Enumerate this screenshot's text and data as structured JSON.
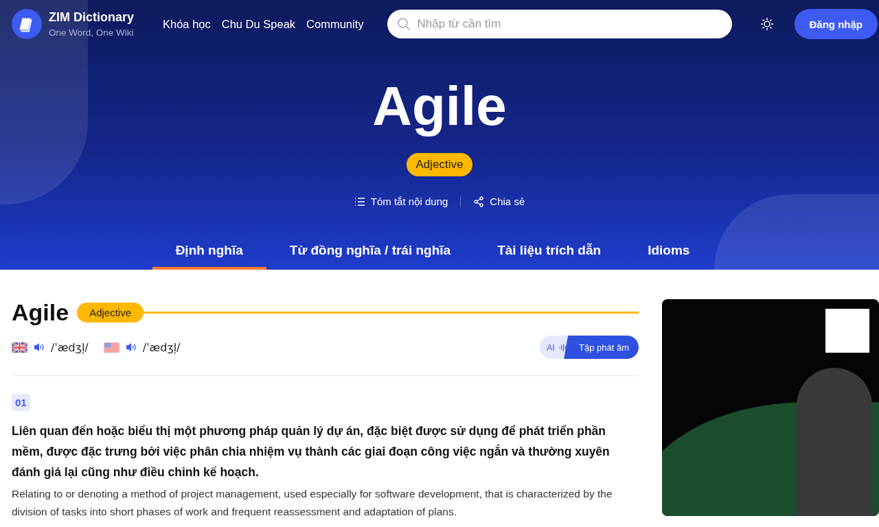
{
  "header": {
    "brand": {
      "name": "ZIM Dictionary",
      "tagline": "One Word, One Wiki"
    },
    "nav": [
      "Khóa học",
      "Chu Du Speak",
      "Community"
    ],
    "search": {
      "placeholder": "Nhập từ cần tìm"
    },
    "login": "Đăng nhập"
  },
  "hero": {
    "word": "Agile",
    "pos": "Adjective",
    "actions": [
      {
        "kind": "summary",
        "label": "Tóm tắt nội dung"
      },
      {
        "kind": "share",
        "label": "Chia sẻ"
      }
    ]
  },
  "tabs": [
    {
      "label": "Định nghĩa",
      "selected": true
    },
    {
      "label": "Từ đồng nghĩa / trái nghĩa",
      "selected": false
    },
    {
      "label": "Tài liệu trích dẫn",
      "selected": false
    },
    {
      "label": "Idioms",
      "selected": false
    }
  ],
  "entry": {
    "word": "Agile",
    "pos": "Adjective",
    "pronunciations": [
      {
        "kind": "uk",
        "ipa": "/ˈædʒl̩/"
      },
      {
        "kind": "us",
        "ipa": "/ˈædʒl̩/"
      }
    ],
    "practice": {
      "ai": "AI",
      "label": "Tập phát âm"
    },
    "senses": [
      {
        "number": "01",
        "vi": "Liên quan đến hoặc biểu thị một phương pháp quản lý dự án, đặc biệt được sử dụng để phát triển phần mềm, được đặc trưng bởi việc phân chia nhiệm vụ thành các giai đoạn công việc ngắn và thường xuyên đánh giá lại cũng như điều chỉnh kế hoạch.",
        "en": "Relating to or denoting a method of project management, used especially for software development, that is characterized by the division of tasks into short phases of work and frequent reassessment and adaptation of plans."
      }
    ]
  }
}
